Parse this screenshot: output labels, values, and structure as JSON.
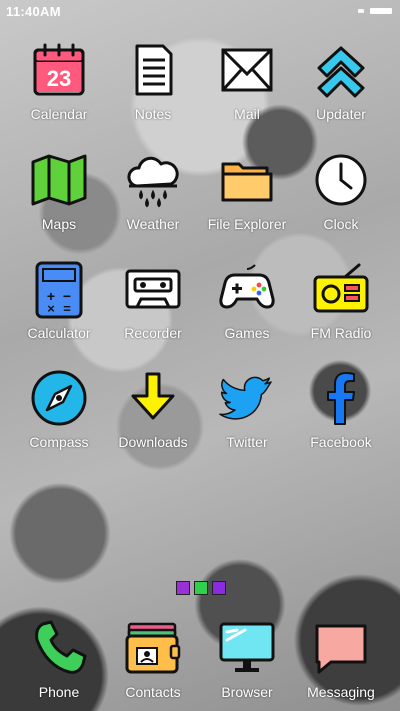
{
  "status": {
    "time": "11:40AM"
  },
  "apps": [
    {
      "label": "Calendar",
      "icon": "calendar-icon",
      "date": "23"
    },
    {
      "label": "Notes",
      "icon": "notes-icon"
    },
    {
      "label": "Mail",
      "icon": "mail-icon"
    },
    {
      "label": "Updater",
      "icon": "updater-icon"
    },
    {
      "label": "Maps",
      "icon": "maps-icon"
    },
    {
      "label": "Weather",
      "icon": "weather-icon"
    },
    {
      "label": "File Explorer",
      "icon": "folder-icon"
    },
    {
      "label": "Clock",
      "icon": "clock-icon"
    },
    {
      "label": "Calculator",
      "icon": "calculator-icon"
    },
    {
      "label": "Recorder",
      "icon": "cassette-icon"
    },
    {
      "label": "Games",
      "icon": "gamepad-icon"
    },
    {
      "label": "FM Radio",
      "icon": "radio-icon"
    },
    {
      "label": "Compass",
      "icon": "compass-icon"
    },
    {
      "label": "Downloads",
      "icon": "download-icon"
    },
    {
      "label": "Twitter",
      "icon": "twitter-icon"
    },
    {
      "label": "Facebook",
      "icon": "facebook-icon"
    }
  ],
  "page_indicator": [
    "#9b30d9",
    "#2fd04a",
    "#8a2be2"
  ],
  "dock": [
    {
      "label": "Phone",
      "icon": "phone-icon"
    },
    {
      "label": "Contacts",
      "icon": "contacts-icon"
    },
    {
      "label": "Browser",
      "icon": "monitor-icon"
    },
    {
      "label": "Messaging",
      "icon": "message-icon"
    }
  ]
}
